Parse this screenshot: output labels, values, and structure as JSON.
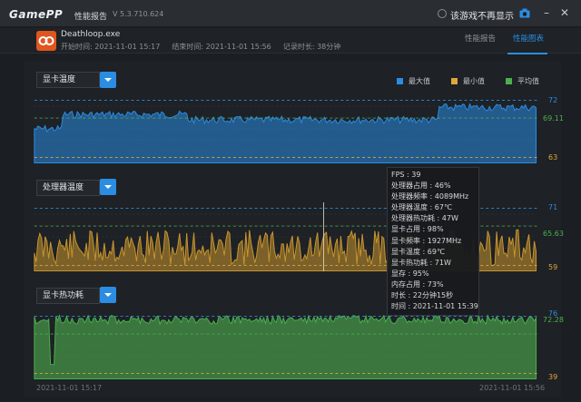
{
  "app": {
    "logo": "GamePP",
    "title": "性能报告",
    "version": "V 5.3.710.624",
    "hide_checkbox_label": "该游戏不再显示"
  },
  "header": {
    "game_name": "Deathloop.exe",
    "start_time": "开始时间: 2021-11-01 15:17",
    "end_time": "结束时间: 2021-11-01 15:56",
    "duration": "记录时长: 38分钟"
  },
  "tabs": [
    {
      "label": "性能报告",
      "active": false
    },
    {
      "label": "性能图表",
      "active": true
    }
  ],
  "legend": [
    {
      "label": "最大值",
      "color": "#2a8de3"
    },
    {
      "label": "最小值",
      "color": "#e0a63a"
    },
    {
      "label": "平均值",
      "color": "#4caf50"
    }
  ],
  "charts": [
    {
      "label": "显卡温度",
      "max": "72",
      "avg": "69.11",
      "min": "63",
      "color": "#2a8de3"
    },
    {
      "label": "处理器温度",
      "max": "71",
      "avg": "65.63",
      "min": "59",
      "color": "#c8952e"
    },
    {
      "label": "显卡热功耗",
      "max": "76",
      "avg": "72.28",
      "min": "39",
      "color": "#4caf50"
    }
  ],
  "axis": {
    "start": "2021-11-01 15:17",
    "end": "2021-11-01 15:56"
  },
  "tooltip": [
    "FPS : 39",
    "处理器占用 : 46%",
    "处理器频率 : 4089MHz",
    "处理器温度 : 67℃",
    "处理器热功耗 : 47W",
    "显卡占用 : 98%",
    "显卡频率 : 1927MHz",
    "显卡温度 : 69℃",
    "显卡热功耗 : 71W",
    "显存 : 95%",
    "内存占用 : 73%",
    "时长 : 22分钟15秒",
    "时间 : 2021-11-01 15:39"
  ],
  "colors": {
    "max": "#2a8de3",
    "min": "#e0a63a",
    "avg": "#4caf50",
    "accent": "#2a8de3"
  }
}
